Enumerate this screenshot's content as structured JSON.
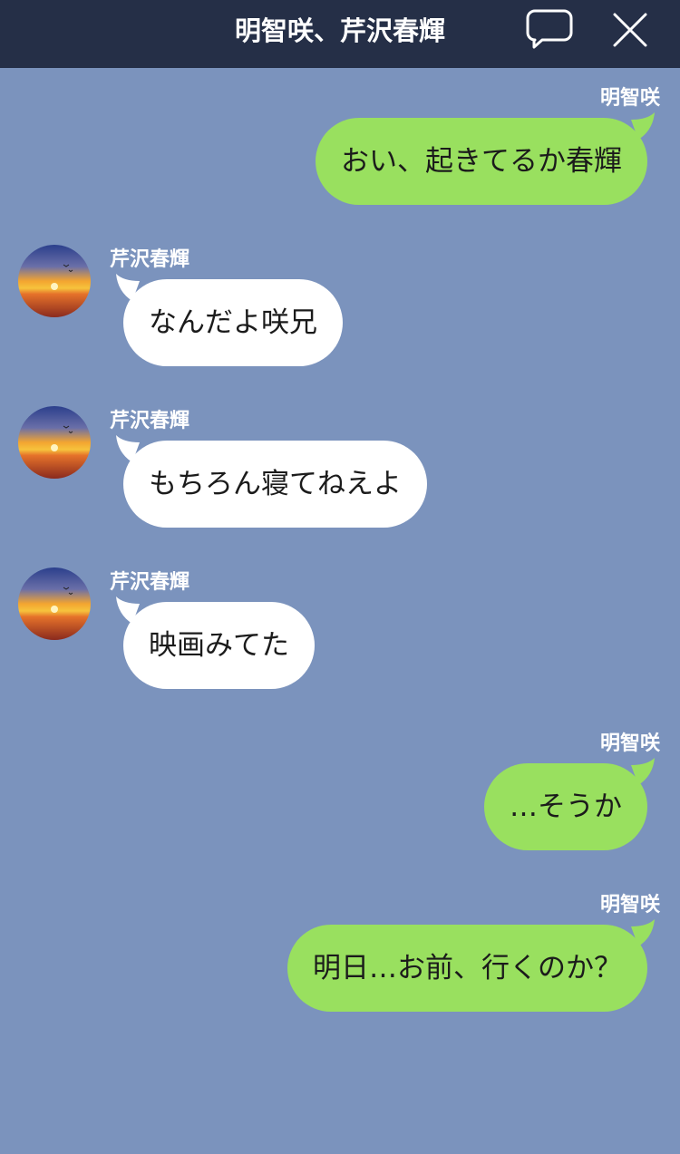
{
  "header": {
    "title": "明智咲、芹沢春輝",
    "colors": {
      "bar": "#252f47",
      "text": "#ffffff"
    },
    "icons": {
      "chat": "speech-bubble-icon",
      "close": "close-icon"
    }
  },
  "chat": {
    "background": "#7b93bd",
    "outgoing_color": "#99e05f",
    "incoming_color": "#ffffff",
    "messages": [
      {
        "direction": "outgoing",
        "sender": "明智咲",
        "text": "おい、起きてるか春輝"
      },
      {
        "direction": "incoming",
        "sender": "芹沢春輝",
        "text": "なんだよ咲兄",
        "avatar": "sunset-avatar"
      },
      {
        "direction": "incoming",
        "sender": "芹沢春輝",
        "text": "もちろん寝てねえよ",
        "avatar": "sunset-avatar"
      },
      {
        "direction": "incoming",
        "sender": "芹沢春輝",
        "text": "映画みてた",
        "avatar": "sunset-avatar"
      },
      {
        "direction": "outgoing",
        "sender": "明智咲",
        "text": "…そうか"
      },
      {
        "direction": "outgoing",
        "sender": "明智咲",
        "text": "明日…お前、行くのか？"
      }
    ]
  }
}
